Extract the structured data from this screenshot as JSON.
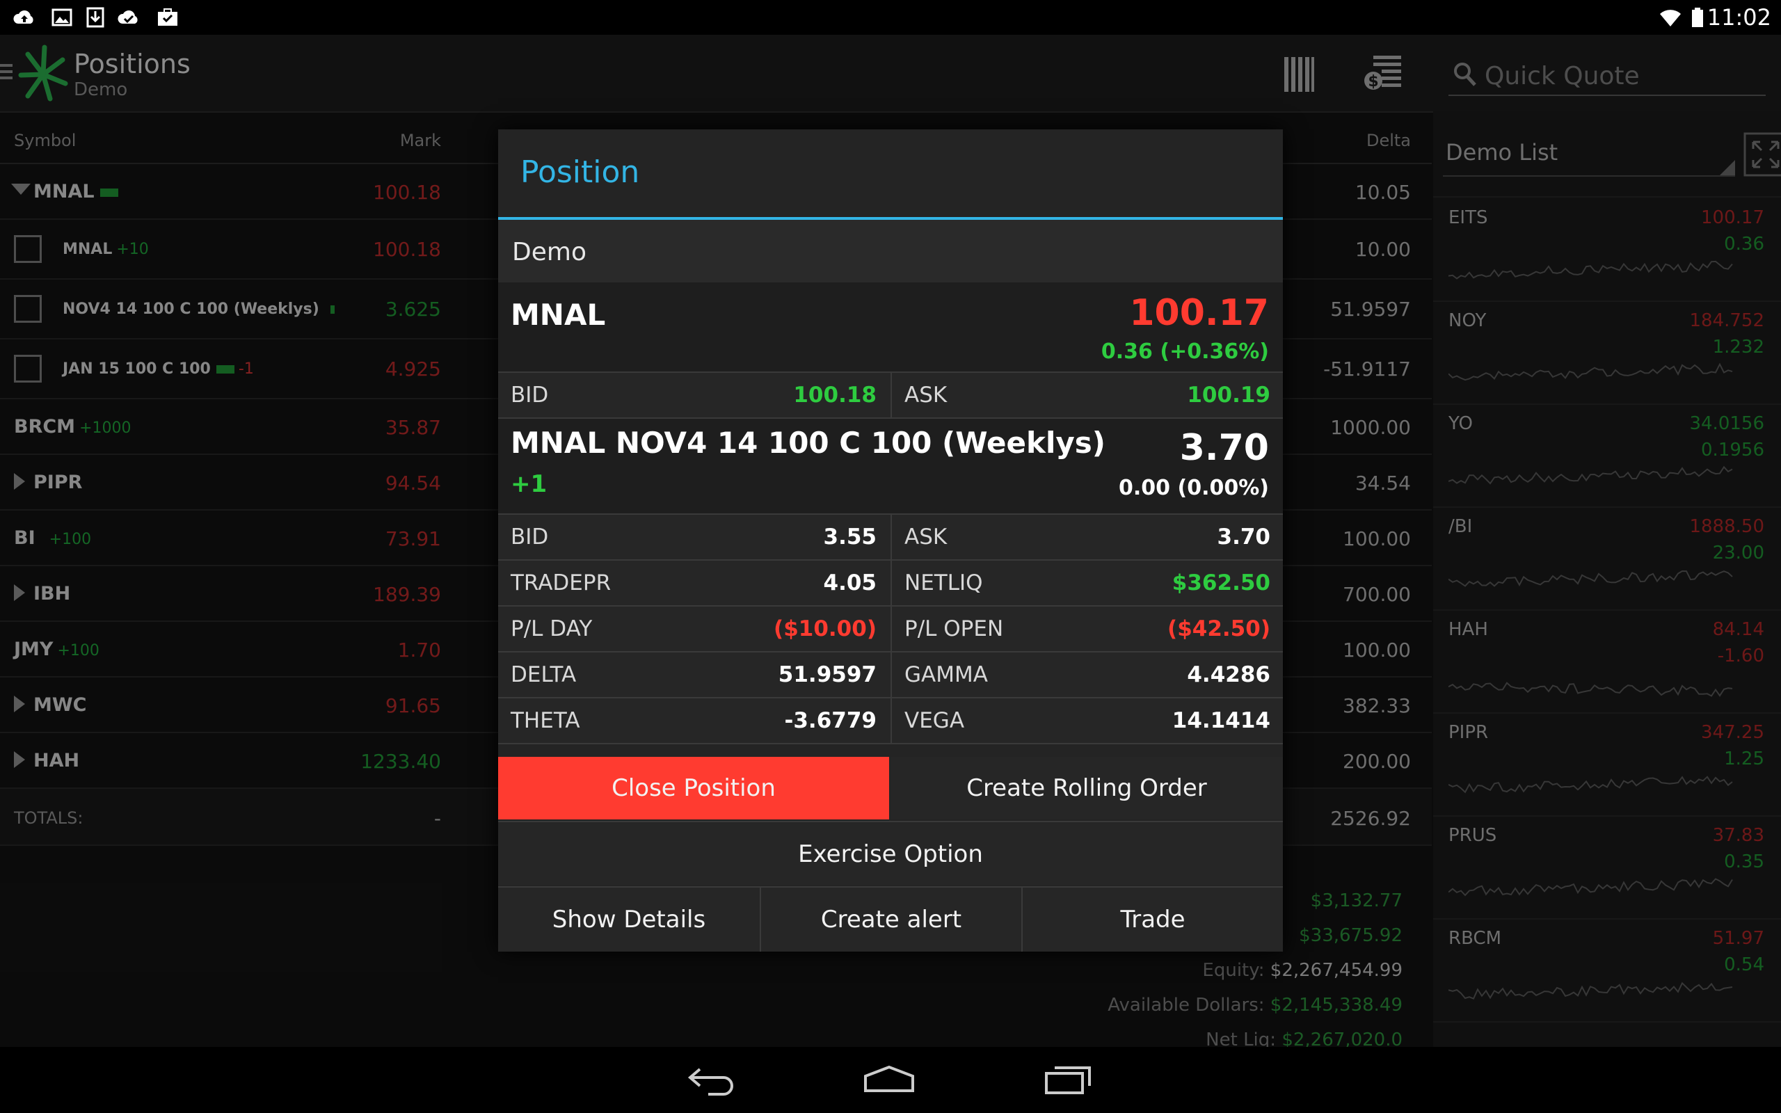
{
  "status_bar": {
    "time": "11:02"
  },
  "action_bar": {
    "title": "Positions",
    "subtitle": "Demo",
    "search_placeholder": "Quick Quote"
  },
  "table": {
    "headers": {
      "symbol": "Symbol",
      "mark": "Mark",
      "delta": "Delta"
    },
    "rows": [
      {
        "symbol": "MNAL",
        "qty": "",
        "mark": "100.18",
        "delta": "10.05"
      },
      {
        "symbol": "MNAL",
        "qty": "+10",
        "mark": "100.18",
        "delta": "10.00"
      },
      {
        "symbol": "NOV4 14 100 C 100 (Weeklys)",
        "qty": "",
        "mark": "3.625",
        "delta": "51.9597"
      },
      {
        "symbol": "JAN 15 100 C 100",
        "qty": "-1",
        "mark": "4.925",
        "delta": "-51.9117"
      },
      {
        "symbol": "BRCM",
        "qty": "+1000",
        "mark": "35.87",
        "delta": "1000.00"
      },
      {
        "symbol": "PIPR",
        "qty": "",
        "mark": "94.54",
        "delta": "34.54"
      },
      {
        "symbol": "BI",
        "qty": "+100",
        "mark": "73.91",
        "delta": "100.00"
      },
      {
        "symbol": "IBH",
        "qty": "",
        "mark": "189.39",
        "delta": "700.00"
      },
      {
        "symbol": "JMY",
        "qty": "+100",
        "mark": "1.70",
        "delta": "100.00"
      },
      {
        "symbol": "MWC",
        "qty": "",
        "mark": "91.65",
        "delta": "382.33"
      },
      {
        "symbol": "HAH",
        "qty": "",
        "mark": "1233.40",
        "delta": "200.00"
      }
    ],
    "totals": {
      "label": "TOTALS:",
      "mark": "-",
      "delta": "2526.92"
    }
  },
  "summary": {
    "line1": "$3,132.77",
    "line2": "$33,675.92",
    "equity_label": "Equity:",
    "equity_value": "$2,267,454.99",
    "avail_label": "Available Dollars:",
    "avail_value": "$2,145,338.49",
    "netliq_label": "Net Liq:",
    "netliq_value": "$2,267,020.0"
  },
  "watchlist": {
    "title": "Demo List",
    "items": [
      {
        "symbol": "EITS",
        "price": "100.17",
        "change": "0.36"
      },
      {
        "symbol": "NOY",
        "price": "184.752",
        "change": "1.232"
      },
      {
        "symbol": "YO",
        "price": "34.0156",
        "change": "0.1956"
      },
      {
        "symbol": "/BI",
        "price": "1888.50",
        "change": "23.00"
      },
      {
        "symbol": "HAH",
        "price": "84.14",
        "change": "-1.60"
      },
      {
        "symbol": "PIPR",
        "price": "347.25",
        "change": "1.25"
      },
      {
        "symbol": "PRUS",
        "price": "37.83",
        "change": "0.35"
      },
      {
        "symbol": "RBCM",
        "price": "51.97",
        "change": "0.54"
      }
    ]
  },
  "dialog": {
    "title": "Position",
    "account": "Demo",
    "underlying": {
      "symbol": "MNAL",
      "price": "100.17",
      "change": "0.36 (+0.36%)",
      "bid_label": "BID",
      "bid": "100.18",
      "ask_label": "ASK",
      "ask": "100.19"
    },
    "option": {
      "symbol": "MNAL NOV4 14 100 C 100 (Weeklys)",
      "qty": "+1",
      "price": "3.70",
      "change": "0.00 (0.00%)"
    },
    "grid": [
      {
        "l1": "BID",
        "v1": "3.55",
        "l2": "ASK",
        "v2": "3.70"
      },
      {
        "l1": "TRADEPR",
        "v1": "4.05",
        "l2": "NETLIQ",
        "v2": "$362.50"
      },
      {
        "l1": "P/L DAY",
        "v1": "($10.00)",
        "l2": "P/L OPEN",
        "v2": "($42.50)"
      },
      {
        "l1": "DELTA",
        "v1": "51.9597",
        "l2": "GAMMA",
        "v2": "4.4286"
      },
      {
        "l1": "THETA",
        "v1": "-3.6779",
        "l2": "VEGA",
        "v2": "14.1414"
      }
    ],
    "buttons": {
      "close_position": "Close Position",
      "create_rolling_order": "Create Rolling Order",
      "exercise_option": "Exercise Option",
      "show_details": "Show Details",
      "create_alert": "Create alert",
      "trade": "Trade"
    }
  },
  "colors": {
    "accent": "#33b5e5",
    "negative": "#ff3b30",
    "positive": "#2ecc40"
  }
}
